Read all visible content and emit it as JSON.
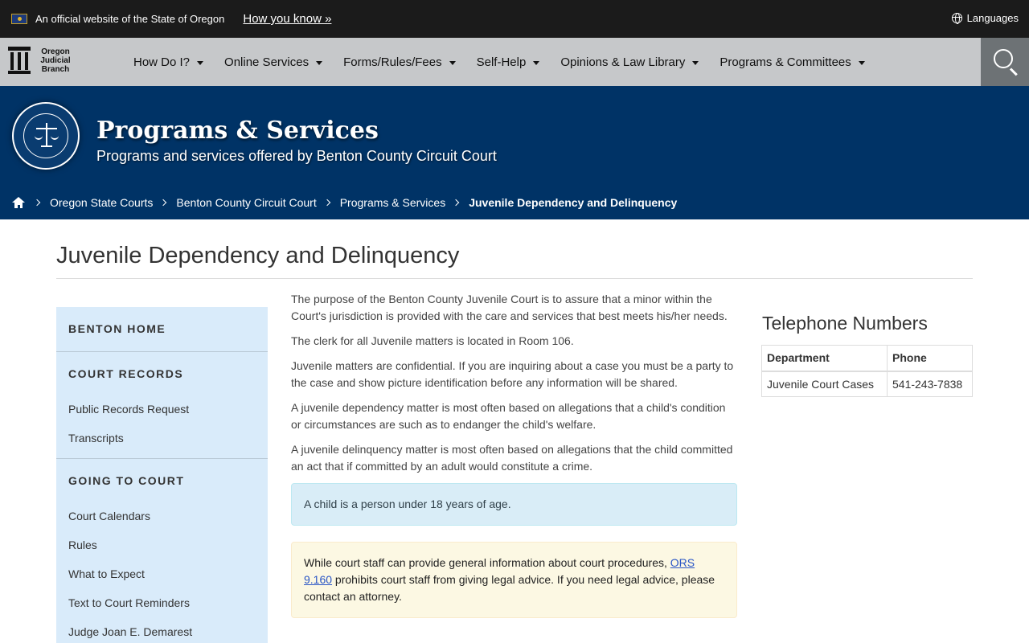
{
  "gov_banner": {
    "official_text": "An official website of the State of Oregon",
    "how_you_know": "How you know »",
    "languages": "Languages"
  },
  "logo": {
    "line1": "Oregon",
    "line2": "Judicial",
    "line3": "Branch"
  },
  "nav": {
    "items": [
      {
        "label": "How Do I?"
      },
      {
        "label": "Online Services"
      },
      {
        "label": "Forms/Rules/Fees"
      },
      {
        "label": "Self-Help"
      },
      {
        "label": "Opinions & Law Library"
      },
      {
        "label": "Programs & Committees"
      }
    ]
  },
  "hero": {
    "title": "Programs & Services",
    "subtitle": "Programs and services offered by Benton County Circuit Court"
  },
  "breadcrumb": {
    "items": [
      {
        "label": "Oregon State Courts"
      },
      {
        "label": "Benton County Circuit Court"
      },
      {
        "label": "Programs & Services"
      }
    ],
    "current": "Juvenile Dependency and Delinquency"
  },
  "page": {
    "title": "Juvenile Dependency and Delinquency"
  },
  "sidebar": {
    "benton_home": "BENTON HOME",
    "court_records": {
      "heading": "COURT RECORDS",
      "links": [
        "Public Records Request",
        "Transcripts"
      ]
    },
    "going_to_court": {
      "heading": "GOING TO COURT",
      "links": [
        "Court Calendars",
        "Rules",
        "What to Expect",
        "Text to Court Reminders",
        "Judge Joan E. Demarest"
      ]
    }
  },
  "content": {
    "paragraphs": [
      "The purpose of the Benton County Juvenile Court is to assure that a minor within the Court's jurisdiction is provided with the care and services that best meets his/her needs.",
      "The clerk for all Juvenile matters is located in Room 106.",
      "Juvenile matters are confidential. If you are inquiring about a case you must be a party to the case and show picture identification before any information will be shared.",
      "A juvenile dependency matter is most often based on allegations that a child's condition or circumstances are such as to endanger the child's welfare.",
      "A juvenile delinquency matter is most often based on allegations that the child committed an act that if committed by an adult would constitute a crime."
    ],
    "info_alert": "A child is a person under 18 years of age.",
    "warning": {
      "before": "While court staff can provide general information about court procedures, ",
      "link": "ORS 9.160",
      "after": " prohibits court staff from giving legal advice. If you need legal advice, please contact an attorney."
    }
  },
  "phones": {
    "title": "Telephone Numbers",
    "headers": {
      "department": "Department",
      "phone": "Phone"
    },
    "rows": [
      {
        "department": "Juvenile Court Cases",
        "phone": "541-243-7838"
      }
    ]
  }
}
